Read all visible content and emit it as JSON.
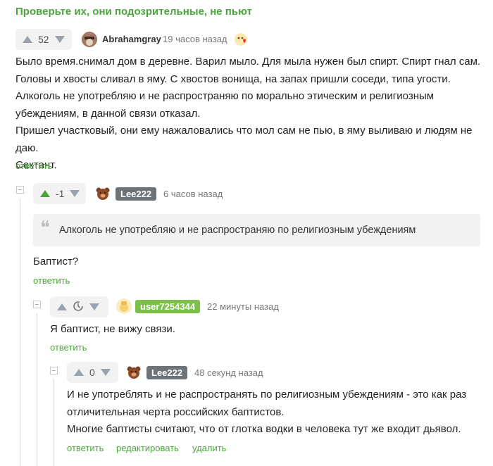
{
  "post": {
    "title": "Проверьте их, они подозрительные, не пьют"
  },
  "colors": {
    "accent": "#4aa63a",
    "user_badge_green": "#7cc04a",
    "user_badge_gray": "#6e7378"
  },
  "comments": [
    {
      "score": "52",
      "author": "Abrahamgray",
      "time": "19 часов назад",
      "avatar_icon": "avatar-icon",
      "emblem_icon": "heart-emblem-icon",
      "lines": [
        "Было время.снимал дом в деревне. Варил мыло. Для мыла нужен был спирт. Спирт гнал сам.",
        "Головы и хвосты сливал в яму. С хвостов вонища, на запах пришли соседи, типа угости.",
        "Алкоголь не употребляю и не распространяю по морально этическим и религиозным",
        "убеждениям, в данной связи отказал.",
        "Пришел участковый, они ему нажаловались что мол сам не пью, в яму выливаю и людям не даю.",
        "Сектант."
      ],
      "reply": "ответить"
    },
    {
      "score": "-1",
      "author": "Lee222",
      "time": "6 часов назад",
      "quote": "Алкоголь не употребляю и не распространяю по религиозным убеждениям",
      "text": "Баптист?",
      "reply": "ответить"
    },
    {
      "score_icon": "clock-icon",
      "author": "user7254344",
      "time": "22 минуты назад",
      "text": "Я баптист, не вижу связи.",
      "reply": "ответить"
    },
    {
      "score": "0",
      "author": "Lee222",
      "time": "48 секунд назад",
      "lines": [
        "И не употреблять и не распространять по религиозным убеждениям - это как раз",
        "отличительная черта российских баптистов.",
        "Многие баптисты считают, что от глотка водки в человека тут же входит дьявол."
      ],
      "reply": "ответить",
      "edit": "редактировать",
      "delete": "удалить"
    }
  ]
}
